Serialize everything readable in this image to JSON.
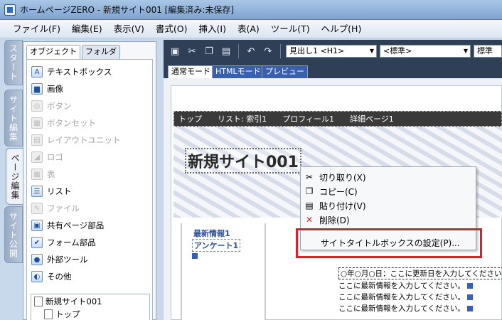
{
  "window": {
    "title": "ホームページZERO - 新規サイト001 [編集済み:未保存]"
  },
  "menu": [
    "ファイル(F)",
    "編集(E)",
    "表示(V)",
    "書式(O)",
    "挿入(I)",
    "表(A)",
    "ツール(T)",
    "ヘルプ(H)"
  ],
  "side_tabs": [
    "スタート",
    "サイト編集",
    "ページ編集",
    "サイト公開"
  ],
  "panel": {
    "tabs": [
      "オブジェクト",
      "フォルダ"
    ],
    "items": [
      {
        "label": "テキストボックス",
        "icon": "text-box-icon",
        "enabled": true
      },
      {
        "label": "画像",
        "icon": "image-icon",
        "enabled": true
      },
      {
        "label": "ボタン",
        "icon": "button-icon",
        "enabled": false
      },
      {
        "label": "ボタンセット",
        "icon": "button-set-icon",
        "enabled": false
      },
      {
        "label": "レイアウトユニット",
        "icon": "layout-unit-icon",
        "enabled": false
      },
      {
        "label": "ロゴ",
        "icon": "logo-icon",
        "enabled": false
      },
      {
        "label": "表",
        "icon": "table-icon",
        "enabled": false
      },
      {
        "label": "リスト",
        "icon": "list-icon",
        "enabled": true
      },
      {
        "label": "ファイル",
        "icon": "file-icon",
        "enabled": false
      },
      {
        "label": "共有ページ部品",
        "icon": "shared-parts-icon",
        "enabled": true
      },
      {
        "label": "フォーム部品",
        "icon": "form-parts-icon",
        "enabled": true
      },
      {
        "label": "外部ツール",
        "icon": "external-tool-icon",
        "enabled": true
      },
      {
        "label": "その他",
        "icon": "other-icon",
        "enabled": true
      }
    ],
    "tree": [
      "新規サイト001",
      "トップ"
    ]
  },
  "toolbar": {
    "heading_select": "見出し1 <H1>",
    "style_select": "<標準>",
    "size_select": "標準"
  },
  "mode_tabs": [
    "通常モード",
    "HTMLモード",
    "プレビュー"
  ],
  "page": {
    "nav": [
      "トップ",
      "リスト: 索引1",
      "プロフィール1",
      "詳細ページ1"
    ],
    "site_title": "新規サイト001",
    "side_links": [
      "最新情報1",
      "アンケート1"
    ],
    "updates": [
      "○年○月○日：ここに更新日を入力してください",
      "ここに最新情報を入力してください。",
      "ここに最新情報を入力してください。",
      "ここに最新情報を入力してください。"
    ]
  },
  "context_menu": {
    "items": [
      {
        "label": "切り取り(X)",
        "icon": "scissors-icon"
      },
      {
        "label": "コピー(C)",
        "icon": "copy-icon"
      },
      {
        "label": "貼り付け(V)",
        "icon": "paste-icon"
      },
      {
        "label": "削除(D)",
        "icon": "delete-icon"
      }
    ],
    "highlighted": "サイトタイトルボックスの設定(P)..."
  },
  "colors": {
    "highlight": "#d9232a",
    "toolbar": "#2f3f56",
    "link": "#2e4f9c"
  }
}
